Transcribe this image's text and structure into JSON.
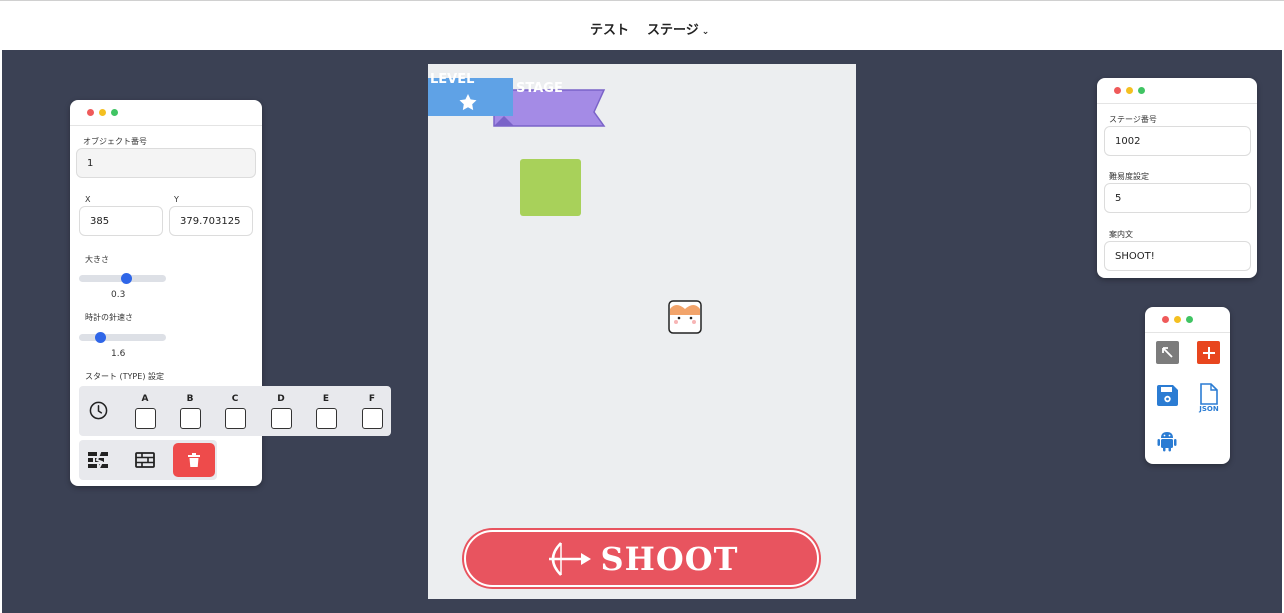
{
  "nav": {
    "test": "テスト",
    "stage": "ステージ"
  },
  "object_panel": {
    "object_number_label": "オブジェクト番号",
    "object_number": "1",
    "x_label": "X",
    "y_label": "Y",
    "x_value": "385",
    "y_value": "379.703125",
    "size_label": "大きさ",
    "size_value": "0.3",
    "size_fraction": 0.55,
    "clock_speed_label": "時計の針速さ",
    "clock_speed_value": "1.6",
    "clock_fraction": 0.25,
    "start_type_label": "スタート (TYPE) 設定",
    "types": [
      "A",
      "B",
      "C",
      "D",
      "E",
      "F"
    ]
  },
  "game": {
    "level_label": "LEVEL",
    "stage_label": "STAGE",
    "shoot_label": "SHOOT"
  },
  "stage_panel": {
    "stage_number_label": "ステージ番号",
    "stage_number": "1002",
    "difficulty_label": "難易度設定",
    "difficulty": "5",
    "guide_label": "案内文",
    "guide": "SHOOT!"
  },
  "tool_panel": {
    "json_label": "JSON"
  },
  "colors": {
    "workspace": "#3b4154",
    "shoot_button": "#e8545f",
    "delete_button": "#ee4b4b",
    "level_banner": "#5fa2e6",
    "stage_banner": "#a48be6",
    "green_block": "#a8d15a",
    "add_button": "#e8461e",
    "icon_blue": "#2b7cd3"
  }
}
